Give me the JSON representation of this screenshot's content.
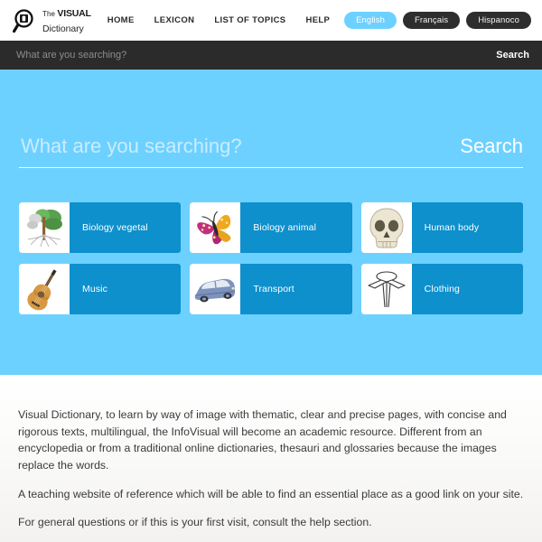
{
  "brand": {
    "icon": "magnifier-book-logo",
    "the": "The",
    "visual": "VISUAL",
    "dictionary": "Dictionary"
  },
  "nav": {
    "items": [
      {
        "label": "HOME"
      },
      {
        "label": "LEXICON"
      },
      {
        "label": "LIST OF TOPICS"
      },
      {
        "label": "HELP"
      }
    ]
  },
  "languages": [
    {
      "label": "English",
      "active": true
    },
    {
      "label": "Français",
      "active": false
    },
    {
      "label": "Hispanoco",
      "active": false
    }
  ],
  "top_search": {
    "value": "",
    "placeholder": "What are you searching?",
    "button_label": "Search"
  },
  "hero_search": {
    "value": "",
    "placeholder": "What are you searching?",
    "button_label": "Search"
  },
  "tiles": [
    {
      "label": "Biology vegetal",
      "icon": "tree-icon"
    },
    {
      "label": "Biology animal",
      "icon": "butterfly-icon"
    },
    {
      "label": "Human body",
      "icon": "skull-icon"
    },
    {
      "label": "Music",
      "icon": "guitar-icon"
    },
    {
      "label": "Transport",
      "icon": "car-icon"
    },
    {
      "label": "Clothing",
      "icon": "shirt-collar-icon"
    }
  ],
  "content": {
    "paragraphs": [
      "Visual Dictionary, to learn by way of image with thematic, clear and precise pages, with concise and rigorous texts, multilingual, the InfoVisual will become an academic resource. Different from an encyclopedia or from a traditional online dictionaries, thesauri and glossaries because the images replace the words.",
      "A teaching website of reference which will be able to find an essential place as a good link on your site.",
      "For general questions or if this is your first visit, consult the help section."
    ]
  },
  "colors": {
    "hero_blue": "#6DD1FF",
    "tile_blue": "#0D90CC",
    "dark_bar": "#2B2B2B",
    "text_dark": "#3A3A3A"
  }
}
